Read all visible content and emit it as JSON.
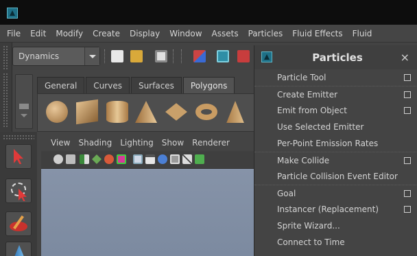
{
  "app": {
    "logo_icon": "maya-logo-icon"
  },
  "menubar": {
    "items": [
      "File",
      "Edit",
      "Modify",
      "Create",
      "Display",
      "Window",
      "Assets",
      "Particles",
      "Fluid Effects",
      "Fluid"
    ]
  },
  "toolbar": {
    "menu_set": "Dynamics"
  },
  "shelf": {
    "tabs": [
      "General",
      "Curves",
      "Surfaces",
      "Polygons"
    ],
    "active_tab": "Polygons",
    "icons": [
      "sphere-icon",
      "cube-icon",
      "cylinder-icon",
      "cone-icon",
      "plane-icon",
      "torus-icon",
      "prism-icon"
    ]
  },
  "panel": {
    "menus": [
      "View",
      "Shading",
      "Lighting",
      "Show",
      "Renderer"
    ]
  },
  "particles_menu": {
    "title": "Particles",
    "close": "×",
    "items": [
      {
        "label": "Particle Tool",
        "option_box": true,
        "separator_before": false
      },
      {
        "label": "Create Emitter",
        "option_box": true,
        "separator_before": true
      },
      {
        "label": "Emit from Object",
        "option_box": true,
        "separator_before": false
      },
      {
        "label": "Use Selected Emitter",
        "option_box": false,
        "separator_before": false
      },
      {
        "label": "Per-Point Emission Rates",
        "option_box": false,
        "separator_before": false
      },
      {
        "label": "Make Collide",
        "option_box": true,
        "separator_before": true
      },
      {
        "label": "Particle Collision Event Editor",
        "option_box": false,
        "separator_before": false
      },
      {
        "label": "Goal",
        "option_box": true,
        "separator_before": true
      },
      {
        "label": "Instancer (Replacement)",
        "option_box": true,
        "separator_before": false
      },
      {
        "label": "Sprite Wizard...",
        "option_box": false,
        "separator_before": false
      },
      {
        "label": "Connect to Time",
        "option_box": false,
        "separator_before": false
      }
    ]
  },
  "colors": {
    "viewport_bg": "#8190a6",
    "menu_bg": "#444444",
    "accent_teal": "#1e6f86"
  }
}
